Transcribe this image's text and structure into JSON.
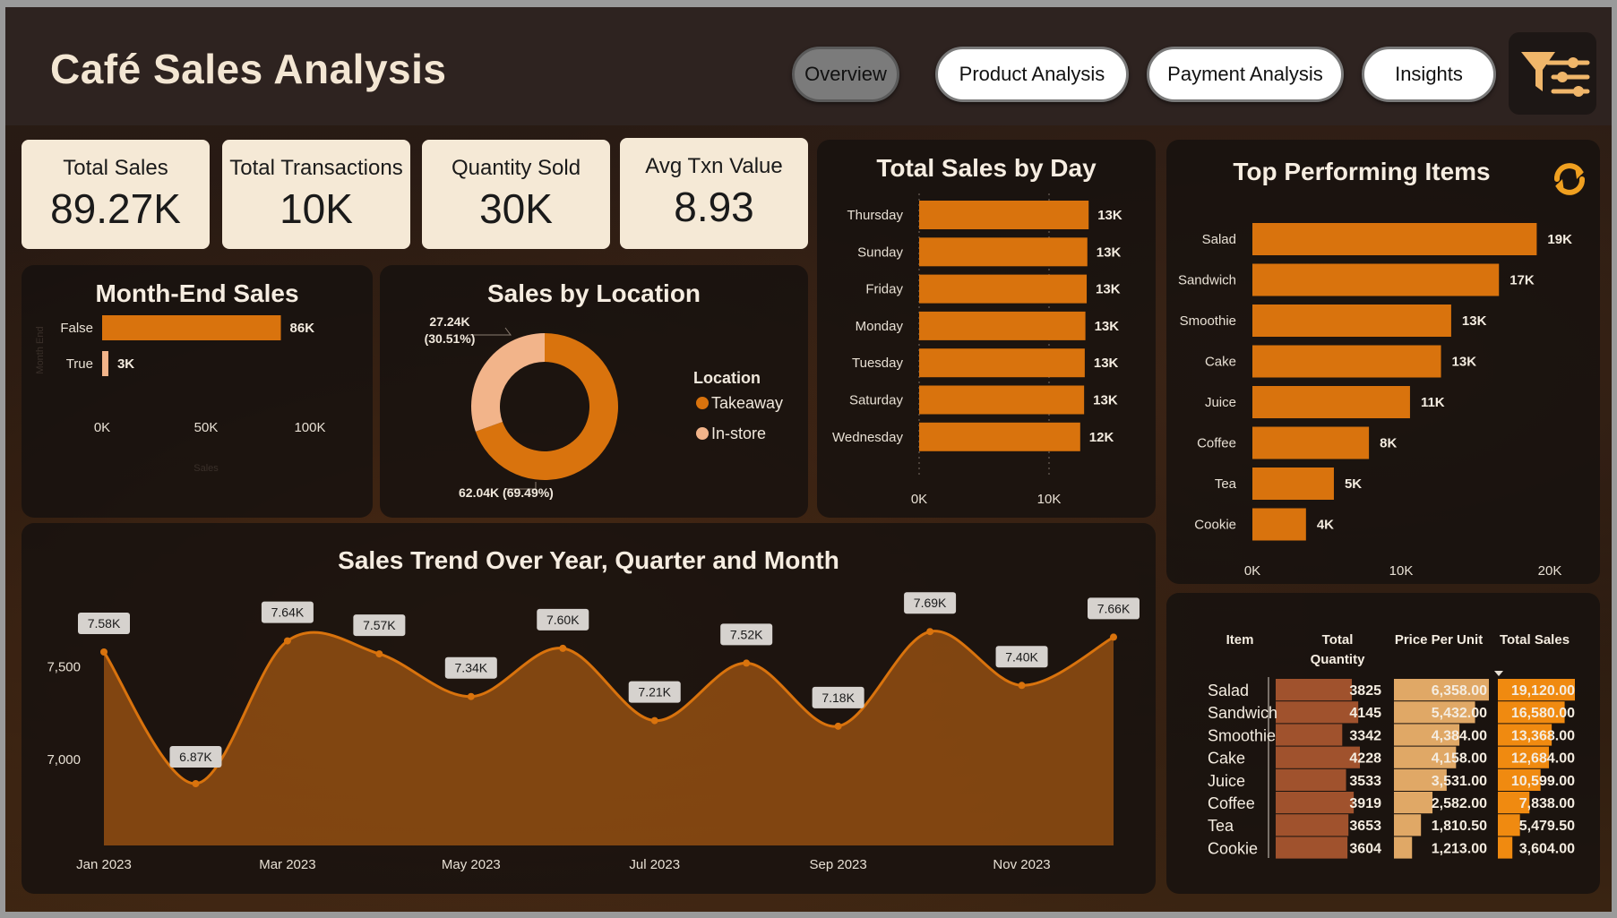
{
  "app": {
    "title": "Café Sales Analysis",
    "nav": [
      "Overview",
      "Product Analysis",
      "Payment Analysis",
      "Insights"
    ],
    "active_tab": "Overview"
  },
  "colors": {
    "accent": "#d9730d",
    "accent_light": "#f2b48a",
    "kpi_bg": "#f5e9d6",
    "panel_bg": "#16110f"
  },
  "icons": [
    "filter-sliders-icon",
    "refresh-icon"
  ],
  "kpis": [
    {
      "label": "Total Sales",
      "value": "89.27K"
    },
    {
      "label": "Total Transactions",
      "value": "10K"
    },
    {
      "label": "Quantity Sold",
      "value": "30K"
    },
    {
      "label": "Avg Txn Value",
      "value": "8.93"
    }
  ],
  "chart_data": [
    {
      "id": "month_end",
      "type": "bar",
      "orientation": "horizontal",
      "title": "Month-End Sales",
      "ylabel": "Month End",
      "xlabel": "Sales",
      "categories": [
        "False",
        "True"
      ],
      "values": [
        86000,
        3000
      ],
      "data_labels": [
        "86K",
        "3K"
      ],
      "xlim": [
        0,
        100000
      ],
      "x_ticks": [
        "0K",
        "50K",
        "100K"
      ]
    },
    {
      "id": "location",
      "type": "pie",
      "donut": true,
      "title": "Sales by Location",
      "legend_title": "Location",
      "legend_position": "right",
      "labels": [
        "Takeaway",
        "In-store"
      ],
      "values": [
        62040,
        27240
      ],
      "data_labels": [
        "62.04K (69.49%)",
        "27.24K (30.51%)"
      ],
      "colors": [
        "#d9730d",
        "#f2b48a"
      ]
    },
    {
      "id": "by_day",
      "type": "bar",
      "orientation": "horizontal",
      "title": "Total Sales by Day",
      "categories": [
        "Thursday",
        "Sunday",
        "Friday",
        "Monday",
        "Tuesday",
        "Saturday",
        "Wednesday"
      ],
      "values": [
        13050,
        12950,
        12900,
        12800,
        12750,
        12700,
        12400
      ],
      "data_labels": [
        "13K",
        "13K",
        "13K",
        "13K",
        "13K",
        "13K",
        "12K"
      ],
      "xlim": [
        0,
        15000
      ],
      "x_ticks": [
        "0K",
        "10K"
      ],
      "grid": true
    },
    {
      "id": "top_items",
      "type": "bar",
      "orientation": "horizontal",
      "title": "Top Performing Items",
      "categories": [
        "Salad",
        "Sandwich",
        "Smoothie",
        "Cake",
        "Juice",
        "Coffee",
        "Tea",
        "Cookie"
      ],
      "values": [
        19120,
        16580,
        13368,
        12684,
        10599,
        7838,
        5479.5,
        3604
      ],
      "data_labels": [
        "19K",
        "17K",
        "13K",
        "13K",
        "11K",
        "8K",
        "5K",
        "4K"
      ],
      "xlim": [
        0,
        20000
      ],
      "x_ticks": [
        "0K",
        "10K",
        "20K"
      ]
    },
    {
      "id": "trend",
      "type": "area",
      "title": "Sales Trend Over Year, Quarter and Month",
      "x": [
        "Jan 2023",
        "Feb 2023",
        "Mar 2023",
        "Apr 2023",
        "May 2023",
        "Jun 2023",
        "Jul 2023",
        "Aug 2023",
        "Sep 2023",
        "Oct 2023",
        "Nov 2023",
        "Dec 2023"
      ],
      "values": [
        7580,
        6870,
        7640,
        7570,
        7340,
        7600,
        7210,
        7520,
        7180,
        7690,
        7400,
        7660
      ],
      "data_labels": [
        "7.58K",
        "6.87K",
        "7.64K",
        "7.57K",
        "7.34K",
        "7.60K",
        "7.21K",
        "7.52K",
        "7.18K",
        "7.69K",
        "7.40K",
        "7.66K"
      ],
      "x_ticks": [
        "Jan 2023",
        "Mar 2023",
        "May 2023",
        "Jul 2023",
        "Sep 2023",
        "Nov 2023"
      ],
      "y_ticks": [
        "7,500",
        "7,000"
      ],
      "ylim": [
        6780,
        7850
      ]
    },
    {
      "id": "item_table",
      "type": "table",
      "columns": [
        "Item",
        "Total Quantity",
        "Price Per Unit",
        "Total Sales"
      ],
      "sort_column": "Total Sales",
      "rows": [
        [
          "Salad",
          "3825",
          "6,358.00",
          "19,120.00"
        ],
        [
          "Sandwich",
          "4145",
          "5,432.00",
          "16,580.00"
        ],
        [
          "Smoothie",
          "3342",
          "4,384.00",
          "13,368.00"
        ],
        [
          "Cake",
          "4228",
          "4,158.00",
          "12,684.00"
        ],
        [
          "Juice",
          "3533",
          "3,531.00",
          "10,599.00"
        ],
        [
          "Coffee",
          "3919",
          "2,582.00",
          "7,838.00"
        ],
        [
          "Tea",
          "3653",
          "1,810.50",
          "5,479.50"
        ],
        [
          "Cookie",
          "3604",
          "1,213.00",
          "3,604.00"
        ]
      ]
    }
  ]
}
